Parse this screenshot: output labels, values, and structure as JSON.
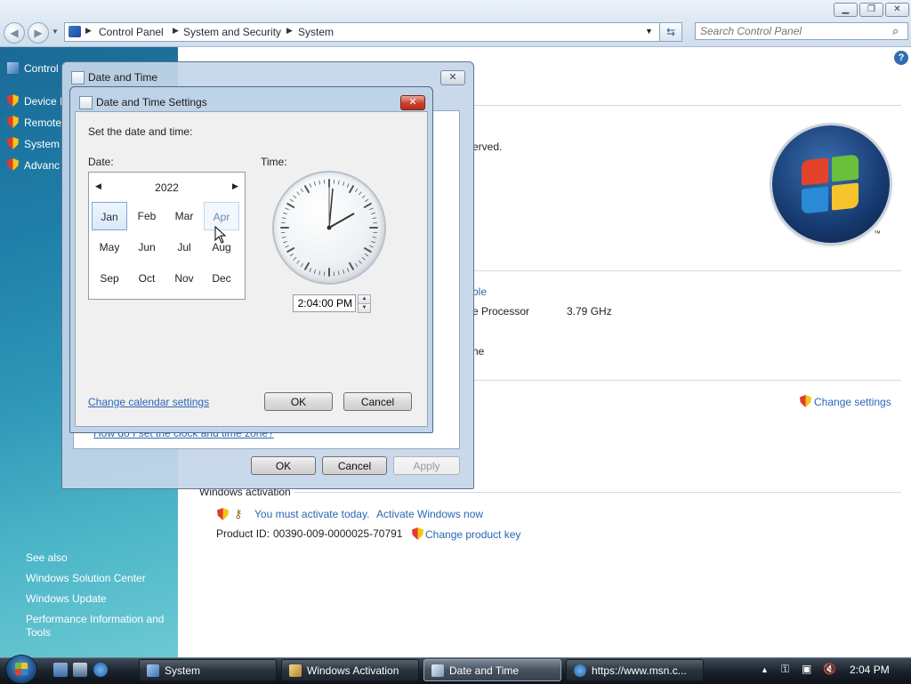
{
  "window": {
    "breadcrumb": [
      "Control Panel",
      "System and Security",
      "System"
    ],
    "search_placeholder": "Search Control Panel",
    "buttons": {
      "minimize": "▁",
      "maximize": "❐",
      "close": "✕"
    }
  },
  "left_pane": {
    "items": [
      {
        "label": "Control"
      },
      {
        "label": "Device I"
      },
      {
        "label": "Remote"
      },
      {
        "label": "System"
      },
      {
        "label": "Advanc"
      }
    ],
    "see_also_header": "See also",
    "see_also": [
      "Windows Solution Center",
      "Windows Update",
      "Performance Information and",
      "Tools"
    ]
  },
  "main": {
    "copyright_fragment": "erved.",
    "rating_fragment": "ble",
    "processor_fragment": "e Processor",
    "processor_speed": "3.79 GHz",
    "computer_name_fragment": "ne",
    "change_settings": "Change settings",
    "activation_header": "Windows activation",
    "activation_warning": "You must activate today.",
    "activation_link": "Activate Windows now",
    "product_id_label": "Product ID:",
    "product_id": "00390-009-0000025-70791",
    "change_product_key": "Change product key",
    "trademark": "™"
  },
  "date_time_dialog": {
    "title": "Date and Time",
    "help_link": "How do I set the clock and time zone?",
    "ok": "OK",
    "cancel": "Cancel",
    "apply": "Apply"
  },
  "date_time_settings": {
    "title": "Date and Time Settings",
    "instruction": "Set the date and time:",
    "date_label": "Date:",
    "time_label": "Time:",
    "year": "2022",
    "months": [
      "Jan",
      "Feb",
      "Mar",
      "Apr",
      "May",
      "Jun",
      "Jul",
      "Aug",
      "Sep",
      "Oct",
      "Nov",
      "Dec"
    ],
    "selected_month": "Jan",
    "hover_month": "Apr",
    "time_value": "2:04:00 PM",
    "calendar_link": "Change calendar settings",
    "ok": "OK",
    "cancel": "Cancel"
  },
  "taskbar": {
    "tasks": [
      {
        "label": "System",
        "active": false
      },
      {
        "label": "Windows Activation",
        "active": false
      },
      {
        "label": "Date and Time",
        "active": true
      },
      {
        "label": "https://www.msn.c...",
        "active": false
      }
    ],
    "clock": "2:04 PM"
  },
  "colors": {
    "link": "#2a66b4",
    "left_pane_top": "#1a6a96",
    "left_pane_bottom": "#6cc9d3",
    "taskbar": "#1b232d"
  }
}
